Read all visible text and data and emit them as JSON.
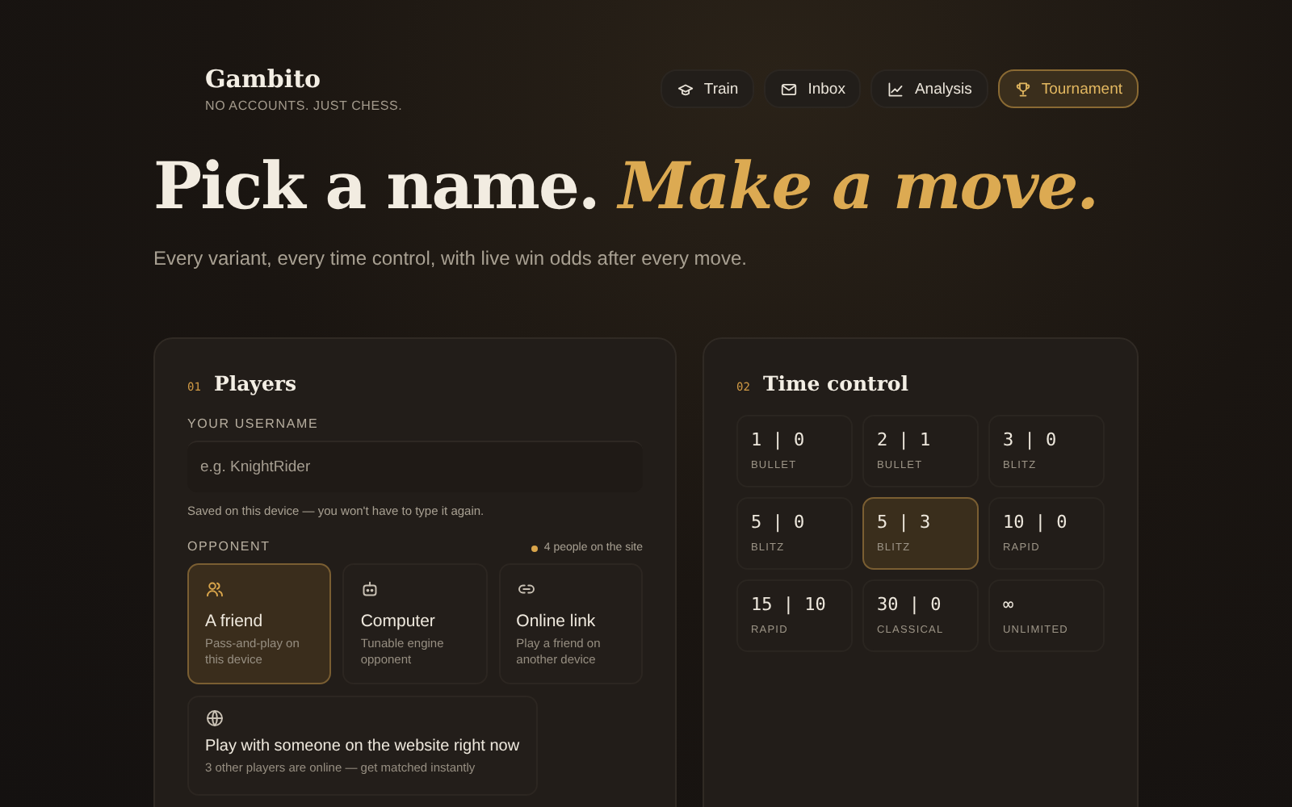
{
  "brand": {
    "name": "Gambito",
    "tagline": "NO ACCOUNTS. JUST CHESS."
  },
  "nav": [
    {
      "label": "Train",
      "kind": "cap",
      "selected": false
    },
    {
      "label": "Inbox",
      "kind": "mail",
      "selected": false
    },
    {
      "label": "Analysis",
      "kind": "chart",
      "selected": false
    },
    {
      "label": "Tournament",
      "kind": "trophy",
      "selected": true
    }
  ],
  "hero": {
    "title": "Pick a name.",
    "title_accent": "Make a move.",
    "subtitle": "Every variant, every time control, with live win odds after every move."
  },
  "players": {
    "number": "01",
    "title": "Players",
    "username_label": "YOUR USERNAME",
    "username": {
      "placeholder": "e.g. KnightRider"
    },
    "hint": "Saved on this device — you won't have to type it again.",
    "opponent_label": "OPPONENT",
    "online": "4 people on the site",
    "opponents": [
      {
        "kind": "friend",
        "title": "A friend",
        "description": "Pass-and-play on this device",
        "selected": true
      },
      {
        "kind": "computer",
        "title": "Computer",
        "description": "Tunable engine opponent",
        "selected": false
      },
      {
        "kind": "link",
        "title": "Online link",
        "description": "Play a friend on another device",
        "selected": false
      }
    ],
    "matchmaking": {
      "title": "Play with someone on the website right now",
      "description": "3 other players are online — get matched instantly"
    }
  },
  "time_control": {
    "number": "02",
    "title": "Time control",
    "options": [
      {
        "time": "1 | 0",
        "category": "BULLET",
        "selected": false
      },
      {
        "time": "2 | 1",
        "category": "BULLET",
        "selected": false
      },
      {
        "time": "3 | 0",
        "category": "BLITZ",
        "selected": false
      },
      {
        "time": "5 | 0",
        "category": "BLITZ",
        "selected": false
      },
      {
        "time": "5 | 3",
        "category": "BLITZ",
        "selected": true
      },
      {
        "time": "10 | 0",
        "category": "RAPID",
        "selected": false
      },
      {
        "time": "15 | 10",
        "category": "RAPID",
        "selected": false
      },
      {
        "time": "30 | 0",
        "category": "CLASSICAL",
        "selected": false
      },
      {
        "time": "∞",
        "category": "UNLIMITED",
        "selected": false
      }
    ]
  }
}
